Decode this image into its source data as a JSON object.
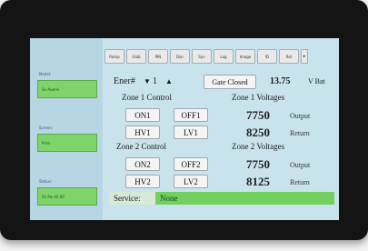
{
  "left_panel": {
    "sections": [
      {
        "label": "Model:",
        "value": "Sn Auerle"
      },
      {
        "label": "Screen:",
        "value": "Prim"
      },
      {
        "label": "Status:",
        "value": "S1 Pw 40 80"
      }
    ]
  },
  "tabs": [
    "Ramp",
    "Glob",
    "PIN",
    "Diar",
    "Syn",
    "Log",
    "Image",
    "ID",
    "Ret"
  ],
  "tab_overflow_icon": "chevron-right-icon",
  "ener": {
    "label": "Ener#",
    "value": "1",
    "down_icon": "triangle-down-icon",
    "up_icon": "triangle-up-icon"
  },
  "gate_button": "Gate Closed",
  "voltage_readout": {
    "value": "13.75",
    "unit": "V Bat"
  },
  "zone1": {
    "control_title": "Zone 1 Control",
    "voltages_title": "Zone 1 Voltages",
    "buttons": [
      "ON1",
      "OFF1",
      "HV1",
      "LV1"
    ],
    "output_value": "7750",
    "output_label": "Output",
    "return_value": "8250",
    "return_label": "Return"
  },
  "zone2": {
    "control_title": "Zone 2 Control",
    "voltages_title": "Zone 2 Voltages",
    "buttons": [
      "ON2",
      "OFF2",
      "HV2",
      "LV2"
    ],
    "output_value": "7750",
    "output_label": "Output",
    "return_value": "8125",
    "return_label": "Return"
  },
  "service": {
    "label": "Service:",
    "value": "None"
  },
  "colors": {
    "screen_bg": "#c9e3ec",
    "green_field": "#72d05e",
    "bezel": "#141414"
  }
}
